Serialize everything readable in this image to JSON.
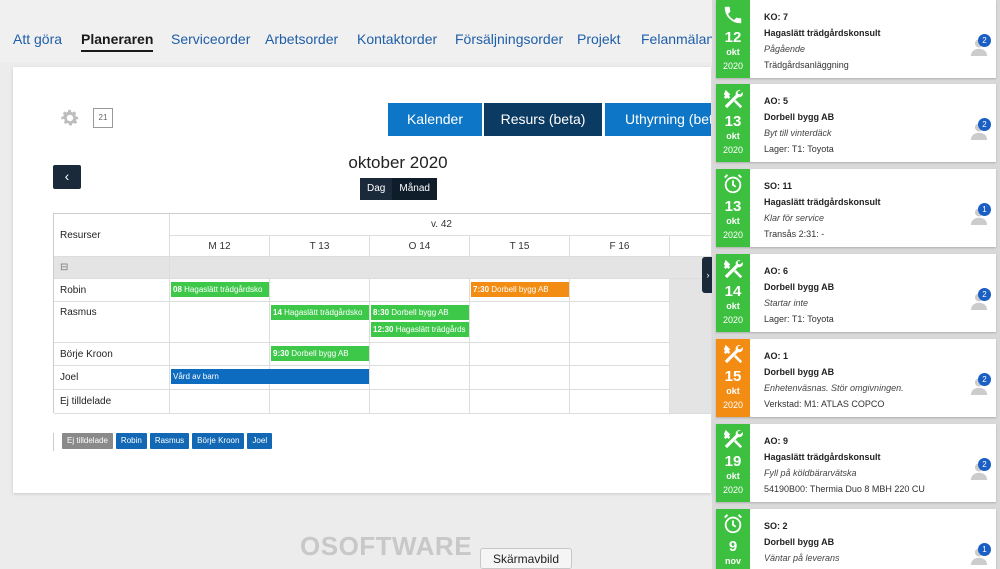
{
  "nav": {
    "tabs": [
      "Att göra",
      "Planeraren",
      "Serviceorder",
      "Arbetsorder",
      "Kontaktorder",
      "Försäljningsorder",
      "Projekt",
      "Felanmälan"
    ],
    "active": "Planeraren"
  },
  "toolbar": {
    "calendar_day": "21",
    "view_buttons": [
      "Kalender",
      "Resurs (beta)",
      "Uthyrning (beta)"
    ],
    "active_view": "Resurs (beta)",
    "prev_symbol": "‹"
  },
  "planner": {
    "month_title": "oktober 2020",
    "toggle": [
      "Dag",
      "Månad"
    ],
    "resources_header": "Resurser",
    "week_label": "v. 42",
    "days": [
      "M 12",
      "T 13",
      "O 14",
      "T 15",
      "F 16"
    ],
    "group_toggle": "⊟",
    "resources": [
      "Robin",
      "Rasmus",
      "Börje Kroon",
      "Joel",
      "Ej tilldelade"
    ],
    "events": [
      {
        "resource": "Robin",
        "day": "M 12",
        "time": "08",
        "text": "Hagaslätt trädgårdsko",
        "color": "green"
      },
      {
        "resource": "Robin",
        "day": "T 15",
        "time": "7:30",
        "text": "Dorbell bygg AB",
        "color": "orange"
      },
      {
        "resource": "Rasmus",
        "day": "T 13",
        "time": "14",
        "text": "Hagaslätt trädgårdsko",
        "color": "green"
      },
      {
        "resource": "Rasmus",
        "day": "O 14",
        "time": "8:30",
        "text": "Dorbell bygg AB",
        "color": "green"
      },
      {
        "resource": "Rasmus",
        "day": "O 14",
        "time": "12:30",
        "text": "Hagaslätt trädgårds",
        "color": "green"
      },
      {
        "resource": "Börje Kroon",
        "day": "T 13",
        "time": "9:30",
        "text": "Dorbell bygg AB",
        "color": "green"
      },
      {
        "resource": "Joel",
        "day": "M 12",
        "time": "",
        "text": "Vård av barn",
        "color": "blue"
      }
    ],
    "legend": [
      "Ej tilldelade",
      "Robin",
      "Rasmus",
      "Börje Kroon",
      "Joel"
    ],
    "collapse_symbol": "›"
  },
  "footer": {
    "logo": "OSOFTWARE",
    "screenshot_button": "Skärmavbild"
  },
  "orders": [
    {
      "icon": "phone-icon",
      "day": "12",
      "month": "okt",
      "year": "2020",
      "code": "KO: 7",
      "customer": "Hagaslätt trädgårdskonsult",
      "status": "Pågående",
      "detail": "Trädgårdsanläggning",
      "users": "2",
      "color": "green"
    },
    {
      "icon": "tools-icon",
      "day": "13",
      "month": "okt",
      "year": "2020",
      "code": "AO: 5",
      "customer": "Dorbell bygg AB",
      "status": "Byt till vinterdäck",
      "detail": "Lager: T1: Toyota",
      "users": "2",
      "color": "green"
    },
    {
      "icon": "alarm-clock-icon",
      "day": "13",
      "month": "okt",
      "year": "2020",
      "code": "SO: 11",
      "customer": "Hagaslätt trädgårdskonsult",
      "status": "Klar för service",
      "detail": "Transås 2:31: -",
      "users": "1",
      "color": "green"
    },
    {
      "icon": "tools-icon",
      "day": "14",
      "month": "okt",
      "year": "2020",
      "code": "AO: 6",
      "customer": "Dorbell bygg AB",
      "status": "Startar inte",
      "detail": "Lager: T1: Toyota",
      "users": "2",
      "color": "green"
    },
    {
      "icon": "tools-icon",
      "day": "15",
      "month": "okt",
      "year": "2020",
      "code": "AO: 1",
      "customer": "Dorbell bygg AB",
      "status": "Enhetenväsnas. Stör omgivningen.",
      "detail": "Verkstad: M1: ATLAS COPCO",
      "users": "2",
      "color": "orange"
    },
    {
      "icon": "tools-icon",
      "day": "19",
      "month": "okt",
      "year": "2020",
      "code": "AO: 9",
      "customer": "Hagaslätt trädgårdskonsult",
      "status": "Fyll på köldbärarvätska",
      "detail": "54190B00: Thermia Duo 8 MBH 220 CU",
      "users": "2",
      "color": "green"
    },
    {
      "icon": "alarm-clock-icon",
      "day": "9",
      "month": "nov",
      "year": "",
      "code": "SO: 2",
      "customer": "Dorbell bygg AB",
      "status": "Väntar på leverans",
      "detail": "",
      "users": "1",
      "color": "green"
    }
  ],
  "colors": {
    "accent_blue": "#0e76c6",
    "dark_navy": "#0b3a62",
    "event_green": "#3dc84a",
    "event_orange": "#f28c13",
    "event_blue": "#0e6cc0"
  }
}
